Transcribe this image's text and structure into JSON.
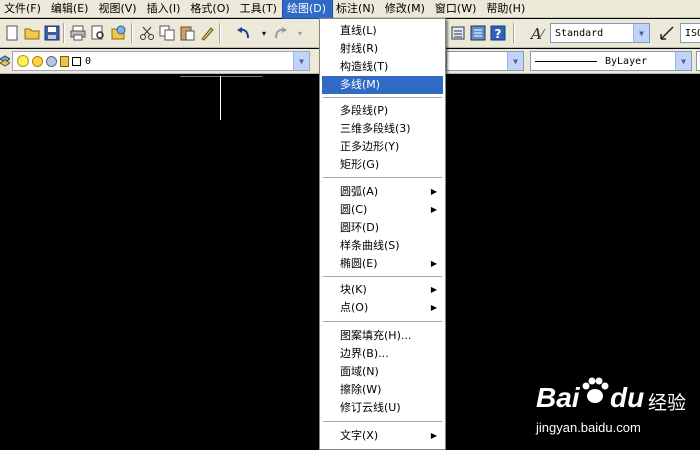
{
  "menubar": {
    "items": [
      {
        "label": "文件(F)"
      },
      {
        "label": "编辑(E)"
      },
      {
        "label": "视图(V)"
      },
      {
        "label": "插入(I)"
      },
      {
        "label": "格式(O)"
      },
      {
        "label": "工具(T)"
      },
      {
        "label": "绘图(D)",
        "active": true
      },
      {
        "label": "标注(N)"
      },
      {
        "label": "修改(M)"
      },
      {
        "label": "窗口(W)"
      },
      {
        "label": "帮助(H)"
      }
    ]
  },
  "toolbar": {
    "text_style": "Standard",
    "dim_style": "ISO",
    "layer": "0",
    "linetype": "ByLayer"
  },
  "draw_menu": {
    "items": [
      {
        "label": "直线(L)"
      },
      {
        "label": "射线(R)"
      },
      {
        "label": "构造线(T)"
      },
      {
        "label": "多线(M)",
        "selected": true
      },
      {
        "label": "多段线(P)"
      },
      {
        "label": "三维多段线(3)"
      },
      {
        "label": "正多边形(Y)"
      },
      {
        "label": "矩形(G)"
      },
      {
        "label": "圆弧(A)",
        "submenu": true
      },
      {
        "label": "圆(C)",
        "submenu": true
      },
      {
        "label": "圆环(D)"
      },
      {
        "label": "样条曲线(S)"
      },
      {
        "label": "椭圆(E)",
        "submenu": true
      },
      {
        "label": "块(K)",
        "submenu": true
      },
      {
        "label": "点(O)",
        "submenu": true
      },
      {
        "label": "图案填充(H)..."
      },
      {
        "label": "边界(B)..."
      },
      {
        "label": "面域(N)"
      },
      {
        "label": "擦除(W)"
      },
      {
        "label": "修订云线(U)"
      },
      {
        "label": "文字(X)",
        "submenu": true
      }
    ]
  },
  "watermark": {
    "logo_text": "Bai",
    "logo_text2": "du",
    "logo_cn": "经验",
    "url": "jingyan.baidu.com"
  },
  "colors": {
    "menu_highlight": "#316ac5",
    "toolbar_bg": "#ece9d8",
    "canvas_bg": "#000000"
  }
}
